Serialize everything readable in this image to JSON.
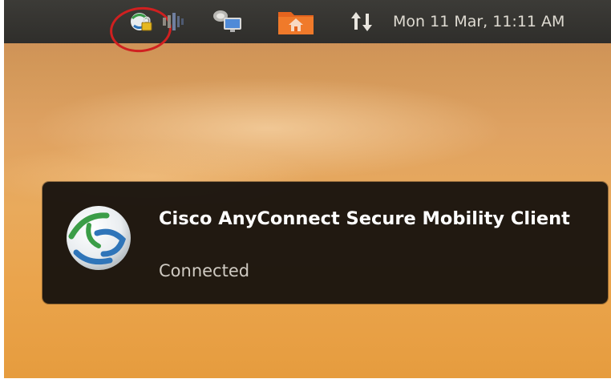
{
  "top_panel": {
    "indicators": [
      {
        "name": "anyconnect-vpn-icon",
        "highlighted": true
      },
      {
        "name": "volume-icon"
      },
      {
        "name": "network-icon"
      },
      {
        "name": "home-folder-icon"
      },
      {
        "name": "network-updown-icon"
      }
    ],
    "clock": "Mon 11 Mar, 11:11 AM"
  },
  "notification": {
    "icon": "cisco-anyconnect-icon",
    "title": "Cisco AnyConnect Secure Mobility Client",
    "body": "Connected"
  },
  "colors": {
    "panel": "#3c3b37",
    "highlight_ring": "#d02020",
    "notification_bg": "#14100d"
  }
}
